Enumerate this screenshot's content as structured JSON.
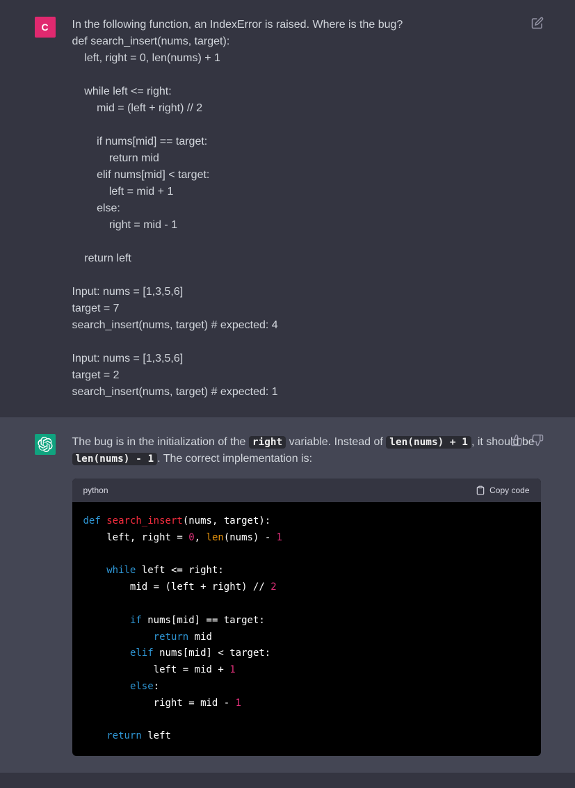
{
  "user": {
    "avatar_letter": "C",
    "message": "In the following function, an IndexError is raised. Where is the bug?\ndef search_insert(nums, target):\n    left, right = 0, len(nums) + 1\n\n    while left <= right:\n        mid = (left + right) // 2\n\n        if nums[mid] == target:\n            return mid\n        elif nums[mid] < target:\n            left = mid + 1\n        else:\n            right = mid - 1\n\n    return left\n\nInput: nums = [1,3,5,6]\ntarget = 7\nsearch_insert(nums, target) # expected: 4\n\nInput: nums = [1,3,5,6]\ntarget = 2\nsearch_insert(nums, target) # expected: 1"
  },
  "assistant": {
    "answer_parts": {
      "t1": "The bug is in the initialization of the ",
      "c1": "right",
      "t2": " variable. Instead of ",
      "c2": "len(nums) + 1",
      "t3": ", it should be ",
      "c3": "len(nums) - 1",
      "t4": ". The correct implementation is:"
    },
    "code_language": "python",
    "copy_label": "Copy code",
    "code_tokens": [
      [
        "kw",
        "def"
      ],
      [
        "sp",
        " "
      ],
      [
        "fn",
        "search_insert"
      ],
      [
        "id",
        "(nums, target):"
      ],
      [
        "nl"
      ],
      [
        "id",
        "    left, right = "
      ],
      [
        "num",
        "0"
      ],
      [
        "id",
        ", "
      ],
      [
        "bi",
        "len"
      ],
      [
        "id",
        "(nums) - "
      ],
      [
        "num",
        "1"
      ],
      [
        "nl"
      ],
      [
        "nl"
      ],
      [
        "id",
        "    "
      ],
      [
        "kw",
        "while"
      ],
      [
        "id",
        " left <= right:"
      ],
      [
        "nl"
      ],
      [
        "id",
        "        mid = (left + right) // "
      ],
      [
        "num",
        "2"
      ],
      [
        "nl"
      ],
      [
        "nl"
      ],
      [
        "id",
        "        "
      ],
      [
        "kw",
        "if"
      ],
      [
        "id",
        " nums[mid] == target:"
      ],
      [
        "nl"
      ],
      [
        "id",
        "            "
      ],
      [
        "kw",
        "return"
      ],
      [
        "id",
        " mid"
      ],
      [
        "nl"
      ],
      [
        "id",
        "        "
      ],
      [
        "kw",
        "elif"
      ],
      [
        "id",
        " nums[mid] < target:"
      ],
      [
        "nl"
      ],
      [
        "id",
        "            left = mid + "
      ],
      [
        "num",
        "1"
      ],
      [
        "nl"
      ],
      [
        "id",
        "        "
      ],
      [
        "kw",
        "else"
      ],
      [
        "id",
        ":"
      ],
      [
        "nl"
      ],
      [
        "id",
        "            right = mid - "
      ],
      [
        "num",
        "1"
      ],
      [
        "nl"
      ],
      [
        "nl"
      ],
      [
        "id",
        "    "
      ],
      [
        "kw",
        "return"
      ],
      [
        "id",
        " left"
      ]
    ]
  }
}
